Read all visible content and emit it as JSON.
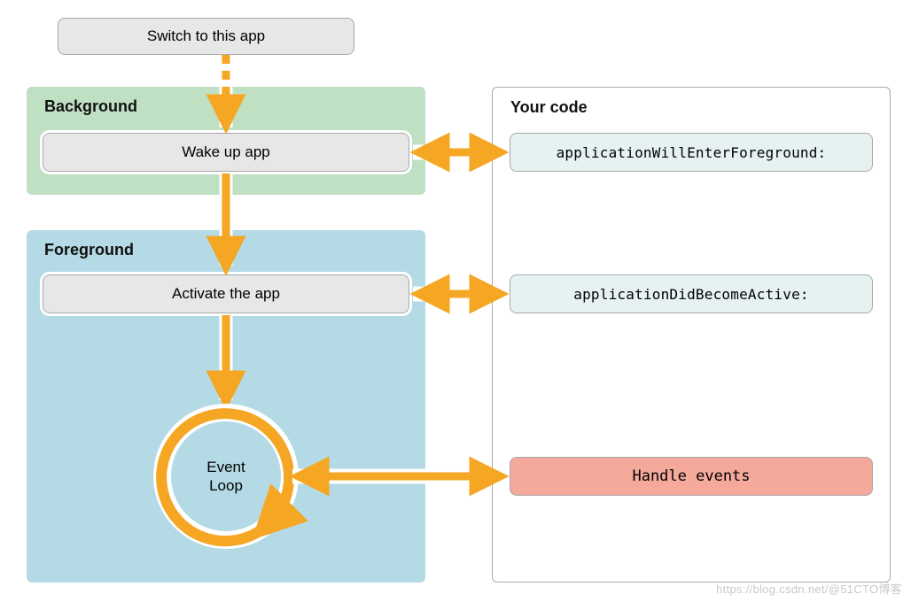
{
  "left": {
    "switch_label": "Switch to this app",
    "background": {
      "title": "Background",
      "wake_label": "Wake up app"
    },
    "foreground": {
      "title": "Foreground",
      "activate_label": "Activate the app",
      "event_loop_label": "Event\nLoop"
    }
  },
  "right": {
    "title": "Your code",
    "delegate_enter_fg": "applicationWillEnterForeground:",
    "delegate_active": "applicationDidBecomeActive:",
    "handle_events": "Handle events"
  },
  "colors": {
    "arrow": "#f5a623",
    "bg_panel": "#c0e0c4",
    "fg_panel": "#b4dbe5",
    "code_panel_border": "#a9a9a9"
  },
  "watermark": "https://blog.csdn.net/@51CTO博客"
}
